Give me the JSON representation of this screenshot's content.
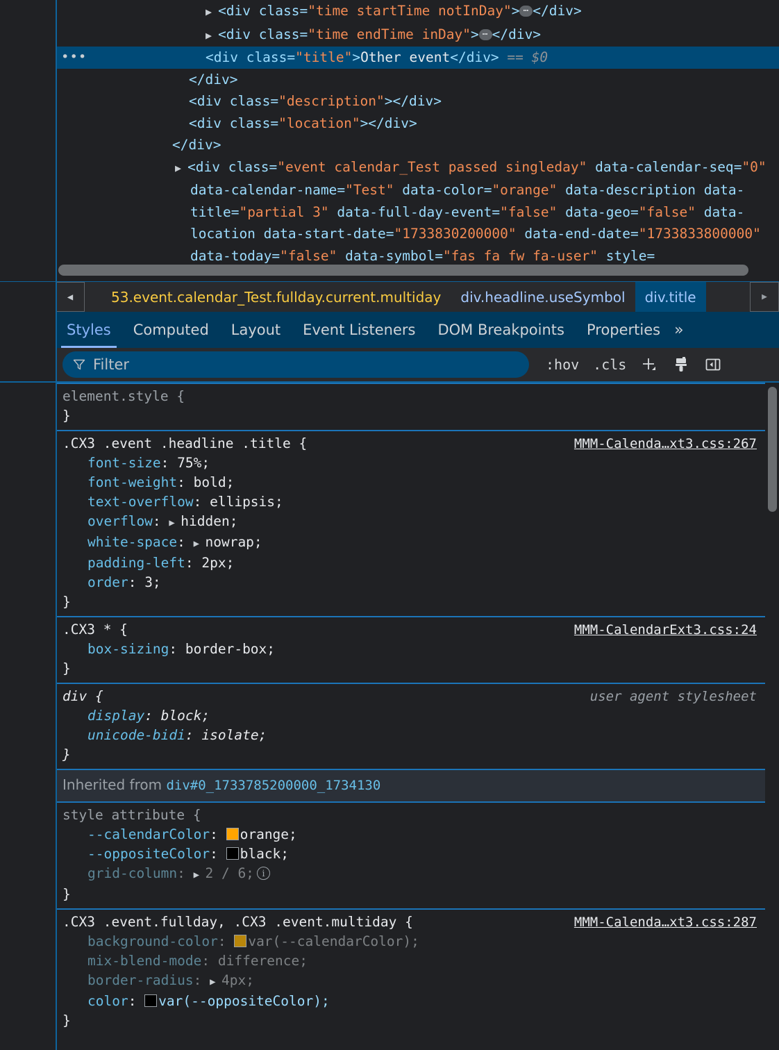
{
  "dom_tree": {
    "rows": [
      {
        "id": "row-starttime",
        "indent": 296,
        "triangle": true,
        "selected": false,
        "segments": [
          {
            "cls": "tw",
            "text": "<div "
          },
          {
            "cls": "attr",
            "text": "class"
          },
          {
            "cls": "tw",
            "text": "="
          },
          {
            "cls": "val",
            "text": "\"time startTime notInDay\""
          },
          {
            "cls": "tw",
            "text": ">"
          },
          {
            "cls": "badge",
            "text": "⋯"
          },
          {
            "cls": "tw",
            "text": "</div>"
          }
        ]
      },
      {
        "id": "row-endtime",
        "indent": 296,
        "triangle": true,
        "selected": false,
        "segments": [
          {
            "cls": "tw",
            "text": "<div "
          },
          {
            "cls": "attr",
            "text": "class"
          },
          {
            "cls": "tw",
            "text": "="
          },
          {
            "cls": "val",
            "text": "\"time endTime inDay\""
          },
          {
            "cls": "tw",
            "text": ">"
          },
          {
            "cls": "badge",
            "text": "⋯"
          },
          {
            "cls": "tw",
            "text": "</div>"
          }
        ]
      },
      {
        "id": "row-title-selected",
        "indent": 296,
        "triangle": false,
        "selected": true,
        "segments": [
          {
            "cls": "tw",
            "text": "<div "
          },
          {
            "cls": "attr",
            "text": "class"
          },
          {
            "cls": "tw",
            "text": "="
          },
          {
            "cls": "val",
            "text": "\"title\""
          },
          {
            "cls": "tw",
            "text": ">"
          },
          {
            "cls": "txt",
            "text": "Other event"
          },
          {
            "cls": "tw",
            "text": "</div> "
          },
          {
            "cls": "dim",
            "text": "== $0"
          }
        ]
      },
      {
        "id": "row-close-headline",
        "indent": 272,
        "triangle": false,
        "selected": false,
        "segments": [
          {
            "cls": "tw",
            "text": "</div>"
          }
        ]
      },
      {
        "id": "row-description",
        "indent": 272,
        "triangle": false,
        "selected": false,
        "segments": [
          {
            "cls": "tw",
            "text": "<div "
          },
          {
            "cls": "attr",
            "text": "class"
          },
          {
            "cls": "tw",
            "text": "="
          },
          {
            "cls": "val",
            "text": "\"description\""
          },
          {
            "cls": "tw",
            "text": "></div>"
          }
        ]
      },
      {
        "id": "row-location",
        "indent": 272,
        "triangle": false,
        "selected": false,
        "segments": [
          {
            "cls": "tw",
            "text": "<div "
          },
          {
            "cls": "attr",
            "text": "class"
          },
          {
            "cls": "tw",
            "text": "="
          },
          {
            "cls": "val",
            "text": "\"location\""
          },
          {
            "cls": "tw",
            "text": "></div>"
          }
        ]
      },
      {
        "id": "row-close-event",
        "indent": 248,
        "triangle": false,
        "selected": false,
        "segments": [
          {
            "cls": "tw",
            "text": "</div>"
          }
        ]
      },
      {
        "id": "row-event-next",
        "indent": 248,
        "triangle": true,
        "wrapped": true,
        "selected": false,
        "segments": [
          {
            "cls": "tw",
            "text": "<div "
          },
          {
            "cls": "attr",
            "text": "class"
          },
          {
            "cls": "tw",
            "text": "="
          },
          {
            "cls": "val",
            "text": "\"event calendar_Test passed singleday\""
          },
          {
            "cls": "tw",
            "text": " "
          },
          {
            "cls": "attr",
            "text": "data-calendar-seq"
          },
          {
            "cls": "tw",
            "text": "="
          },
          {
            "cls": "val",
            "text": "\"0\""
          },
          {
            "cls": "tw",
            "text": " "
          },
          {
            "cls": "attr",
            "text": "data-calendar-name"
          },
          {
            "cls": "tw",
            "text": "="
          },
          {
            "cls": "val",
            "text": "\"Test\""
          },
          {
            "cls": "tw",
            "text": " "
          },
          {
            "cls": "attr",
            "text": "data-color"
          },
          {
            "cls": "tw",
            "text": "="
          },
          {
            "cls": "val",
            "text": "\"orange\""
          },
          {
            "cls": "tw",
            "text": " "
          },
          {
            "cls": "attr",
            "text": "data-description"
          },
          {
            "cls": "tw",
            "text": " "
          },
          {
            "cls": "attr",
            "text": "data-title"
          },
          {
            "cls": "tw",
            "text": "="
          },
          {
            "cls": "val",
            "text": "\"partial 3\""
          },
          {
            "cls": "tw",
            "text": " "
          },
          {
            "cls": "attr",
            "text": "data-full-day-event"
          },
          {
            "cls": "tw",
            "text": "="
          },
          {
            "cls": "val",
            "text": "\"false\""
          },
          {
            "cls": "tw",
            "text": " "
          },
          {
            "cls": "attr",
            "text": "data-geo"
          },
          {
            "cls": "tw",
            "text": "="
          },
          {
            "cls": "val",
            "text": "\"false\""
          },
          {
            "cls": "tw",
            "text": " "
          },
          {
            "cls": "attr",
            "text": "data-location"
          },
          {
            "cls": "tw",
            "text": " "
          },
          {
            "cls": "attr",
            "text": "data-start-date"
          },
          {
            "cls": "tw",
            "text": "="
          },
          {
            "cls": "val",
            "text": "\"1733830200000\""
          },
          {
            "cls": "tw",
            "text": " "
          },
          {
            "cls": "attr",
            "text": "data-end-date"
          },
          {
            "cls": "tw",
            "text": "="
          },
          {
            "cls": "val",
            "text": "\"1733833800000\""
          },
          {
            "cls": "tw",
            "text": " "
          },
          {
            "cls": "attr",
            "text": "data-today"
          },
          {
            "cls": "tw",
            "text": "="
          },
          {
            "cls": "val",
            "text": "\"false\""
          },
          {
            "cls": "tw",
            "text": " "
          },
          {
            "cls": "attr",
            "text": "data-symbol"
          },
          {
            "cls": "tw",
            "text": "="
          },
          {
            "cls": "val",
            "text": "\"fas fa fw fa-user\""
          },
          {
            "cls": "tw",
            "text": " "
          },
          {
            "cls": "attr",
            "text": "style"
          },
          {
            "cls": "tw",
            "text": "="
          }
        ]
      }
    ]
  },
  "breadcrumb": {
    "scroll_left_icon": "◀",
    "scroll_right_icon": "▶",
    "crumbs": [
      {
        "label": "53.event.calendar_Test.fullday.current.multiday",
        "truncated": true,
        "active": false
      },
      {
        "label": "div.headline.useSymbol",
        "truncated": false,
        "active": false
      },
      {
        "label": "div.title",
        "truncated": false,
        "active": true
      }
    ]
  },
  "tabs": {
    "items": [
      {
        "label": "Styles",
        "active": true
      },
      {
        "label": "Computed",
        "active": false
      },
      {
        "label": "Layout",
        "active": false
      },
      {
        "label": "Event Listeners",
        "active": false
      },
      {
        "label": "DOM Breakpoints",
        "active": false
      },
      {
        "label": "Properties",
        "active": false
      }
    ],
    "overflow_label": "»"
  },
  "filter_toolbar": {
    "filter_placeholder": "Filter",
    "hov_label": ":hov",
    "cls_label": ".cls",
    "new_rule_label": "+",
    "copy_styles_title": "paintbrush-icon",
    "sidebar_toggle_title": "sidebar-toggle-icon"
  },
  "styles": {
    "rules": [
      {
        "id": "rule-element-style",
        "selector": "element.style {",
        "selector_muted": true,
        "origin": "",
        "italic": false,
        "declarations": []
      },
      {
        "id": "rule-cx3-title",
        "selector": ".CX3 .event .headline .title {",
        "selector_muted": false,
        "origin": "MMM-Calenda…xt3.css:267",
        "italic": false,
        "declarations": [
          {
            "name": "font-size",
            "value": "75%;",
            "expander": false,
            "inactive": false
          },
          {
            "name": "font-weight",
            "value": "bold;",
            "expander": false,
            "inactive": false
          },
          {
            "name": "text-overflow",
            "value": "ellipsis;",
            "expander": false,
            "inactive": false
          },
          {
            "name": "overflow",
            "value": "hidden;",
            "expander": true,
            "inactive": false
          },
          {
            "name": "white-space",
            "value": "nowrap;",
            "expander": true,
            "inactive": false
          },
          {
            "name": "padding-left",
            "value": "2px;",
            "expander": false,
            "inactive": false
          },
          {
            "name": "order",
            "value": "3;",
            "expander": false,
            "inactive": false
          }
        ]
      },
      {
        "id": "rule-cx3-star",
        "selector": ".CX3 * {",
        "selector_muted": false,
        "origin": "MMM-CalendarExt3.css:24",
        "italic": false,
        "declarations": [
          {
            "name": "box-sizing",
            "value": "border-box;",
            "expander": false,
            "inactive": false
          }
        ]
      },
      {
        "id": "rule-div-ua",
        "selector": "div {",
        "selector_muted": false,
        "origin": "user agent stylesheet",
        "italic": true,
        "declarations": [
          {
            "name": "display",
            "value": "block;",
            "expander": false,
            "inactive": false
          },
          {
            "name": "unicode-bidi",
            "value": "isolate;",
            "expander": false,
            "inactive": false
          }
        ]
      }
    ],
    "inherited": {
      "label": "Inherited from",
      "node": "div#0_1733785200000_1734130"
    },
    "inherited_rules": [
      {
        "id": "rule-style-attribute",
        "selector": "style attribute {",
        "selector_muted": true,
        "origin": "",
        "italic": false,
        "declarations": [
          {
            "name": "--calendarColor",
            "value": "orange;",
            "swatch": "#ffa500",
            "expander": false,
            "inactive": false
          },
          {
            "name": "--oppositeColor",
            "value": "black;",
            "swatch": "#000000",
            "expander": false,
            "inactive": false
          },
          {
            "name": "grid-column",
            "value": "2 / 6;",
            "expander": true,
            "inactive": true,
            "info": true
          }
        ]
      },
      {
        "id": "rule-cx3-fullday-multiday",
        "selector": ".CX3 .event.fullday, .CX3 .event.multiday {",
        "selector_muted": false,
        "origin": "MMM-Calenda…xt3.css:287",
        "italic": false,
        "declarations": [
          {
            "name": "background-color",
            "value": "var(--calendarColor);",
            "swatch": "#b8860b",
            "expander": false,
            "inactive": true
          },
          {
            "name": "mix-blend-mode",
            "value": "difference;",
            "expander": false,
            "inactive": true
          },
          {
            "name": "border-radius",
            "value": "4px;",
            "expander": true,
            "inactive": true
          },
          {
            "name": "color",
            "value": "var(--oppositeColor);",
            "swatch": "#000000",
            "expander": false,
            "inactive": false,
            "value_is_var": true
          }
        ]
      }
    ]
  },
  "colors": {
    "selected_row_bg": "#004a77",
    "panel_bg": "#202124",
    "toolbar_bg": "#292a2d",
    "tab_bar_bg": "#00395c",
    "accent_blue": "#8ab4f8",
    "attr_value_orange": "#f28b54",
    "prop_blue": "#68bfe8",
    "crumb_truncated_yellow": "#f9cb41",
    "rule_divider": "#1b74b8"
  }
}
